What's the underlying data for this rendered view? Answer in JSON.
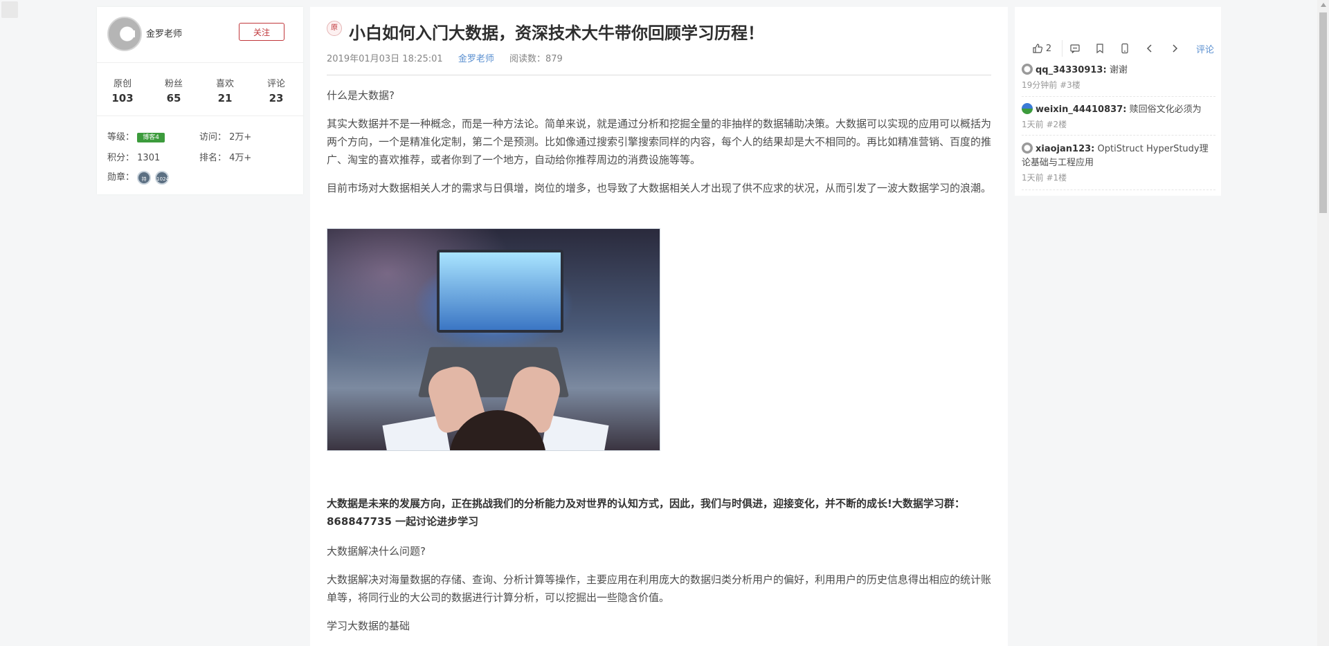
{
  "profile": {
    "author": "金罗老师",
    "follow_label": "关注",
    "stats": [
      {
        "label": "原创",
        "value": "103"
      },
      {
        "label": "粉丝",
        "value": "65"
      },
      {
        "label": "喜欢",
        "value": "21"
      },
      {
        "label": "评论",
        "value": "23"
      }
    ],
    "level_label": "等级：",
    "level_badge": "博客4",
    "visits_label": "访问：",
    "visits_value": "2万+",
    "points_label": "积分：",
    "points_value": "1301",
    "rank_label": "排名：",
    "rank_value": "4万+",
    "medals_label": "勋章：",
    "medal_texts": [
      "持",
      "1024"
    ]
  },
  "article": {
    "orig_tag": "原",
    "title": "小白如何入门大数据，资深技术大牛带你回顾学习历程！",
    "date": "2019年01月03日 18:25:01",
    "author": "金罗老师",
    "reads": "阅读数：879",
    "paragraphs": [
      "什么是大数据?",
      "其实大数据并不是一种概念，而是一种方法论。简单来说，就是通过分析和挖掘全量的非抽样的数据辅助决策。大数据可以实现的应用可以概括为两个方向，一个是精准化定制，第二个是预测。比如像通过搜索引擎搜索同样的内容，每个人的结果却是大不相同的。再比如精准营销、百度的推广、淘宝的喜欢推荐，或者你到了一个地方，自动给你推荐周边的消费设施等等。",
      "目前市场对大数据相关人才的需求与日俱增，岗位的增多，也导致了大数据相关人才出现了供不应求的状况，从而引发了一波大数据学习的浪潮。",
      "大数据是未来的发展方向，正在挑战我们的分析能力及对世界的认知方式，因此，我们与时俱进，迎接变化，并不断的成长!大数据学习群：868847735 一起讨论进步学习",
      "大数据解决什么问题?",
      "大数据解决对海量数据的存储、查询、分析计算等操作，主要应用在利用庞大的数据归类分析用户的偏好，利用用户的历史信息得出相应的统计账单等，将同行业的大公司的数据进行计算分析，可以挖掘出一些隐含价值。",
      "学习大数据的基础"
    ]
  },
  "toolbar": {
    "like_count": "2",
    "comments_link": "评论"
  },
  "comments": [
    {
      "user": "qq_34330913:",
      "text": " 谢谢",
      "time": "19分钟前 #3楼"
    },
    {
      "user": "weixin_44410837:",
      "text": " 赎回俗文化必须为",
      "time": "1天前 #2楼"
    },
    {
      "user": "xiaojan123:",
      "text": " OptiStruct HyperStudy理论基础与工程应用",
      "time": "1天前 #1楼"
    }
  ]
}
